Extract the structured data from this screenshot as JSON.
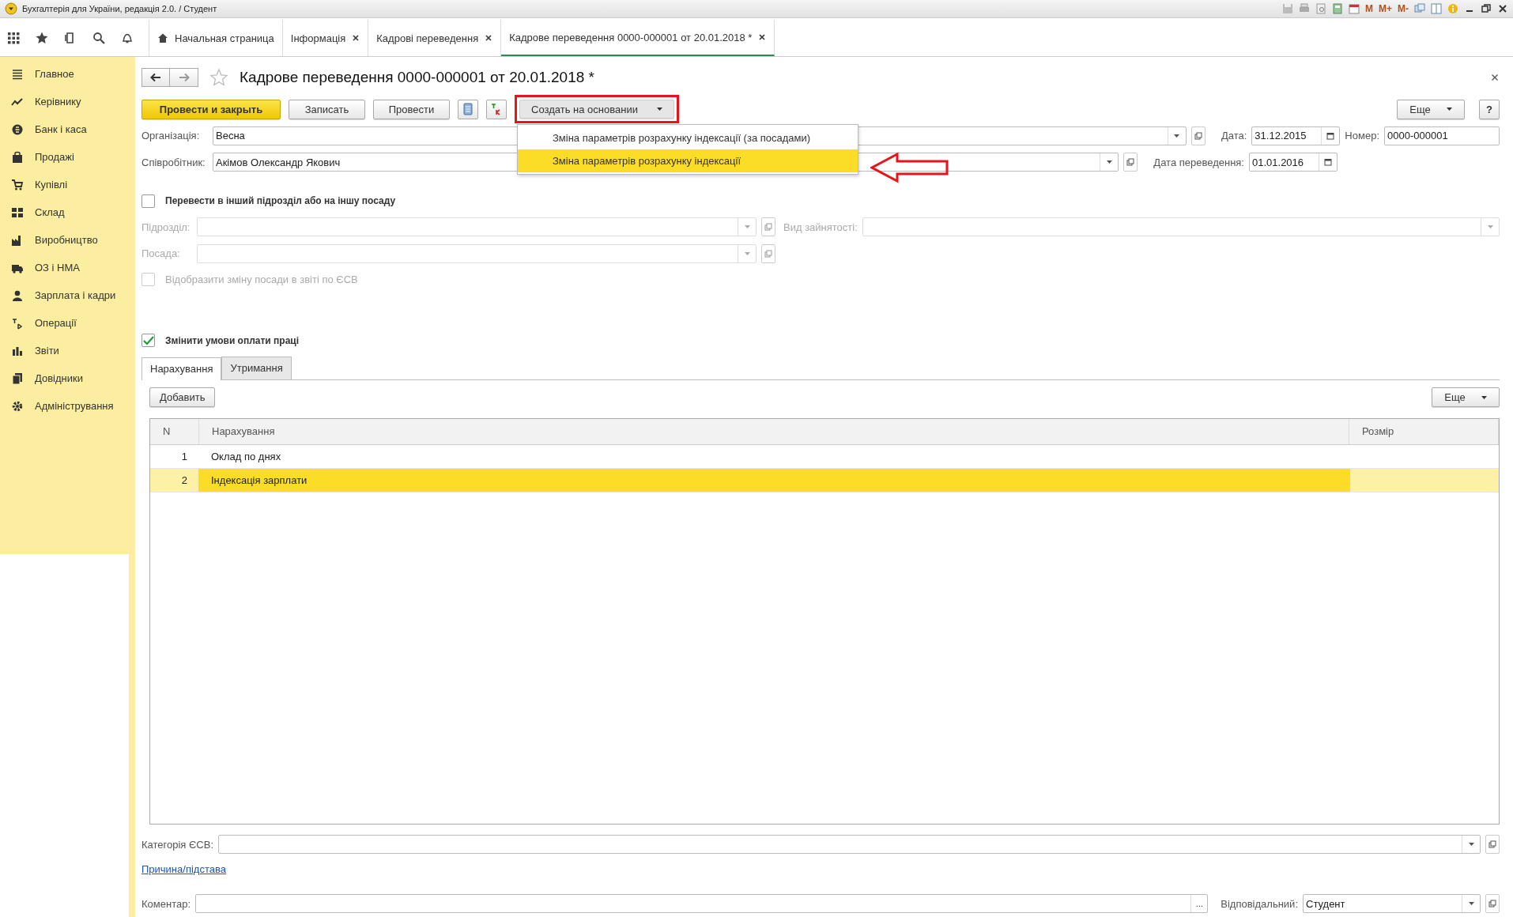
{
  "window": {
    "title": "Бухгалтерія для України, редакція 2.0. / Студент",
    "memory_buttons": [
      "M",
      "M+",
      "M-"
    ]
  },
  "tabs": [
    {
      "label": "Начальная страница",
      "selected": false,
      "closable": false
    },
    {
      "label": "Інформація",
      "selected": false,
      "closable": true
    },
    {
      "label": "Кадрові переведення",
      "selected": false,
      "closable": true
    },
    {
      "label": "Кадрове переведення 0000-000001 от 20.01.2018 *",
      "selected": true,
      "closable": true
    }
  ],
  "sidebar": {
    "items": [
      {
        "label": "Главное"
      },
      {
        "label": "Керівнику"
      },
      {
        "label": "Банк і каса"
      },
      {
        "label": "Продажі"
      },
      {
        "label": "Купівлі"
      },
      {
        "label": "Склад"
      },
      {
        "label": "Виробництво"
      },
      {
        "label": "ОЗ і НМА"
      },
      {
        "label": "Зарплата і кадри"
      },
      {
        "label": "Операції"
      },
      {
        "label": "Звіти"
      },
      {
        "label": "Довідники"
      },
      {
        "label": "Адміністрування"
      }
    ]
  },
  "document": {
    "title": "Кадрове переведення 0000-000001 от 20.01.2018 *",
    "favorite": false
  },
  "buttons": [
    {
      "label": "Провести и закрыть",
      "kind": "primary"
    },
    {
      "label": "Записать",
      "kind": "normal"
    },
    {
      "label": "Провести",
      "kind": "normal"
    }
  ],
  "create_based_on": {
    "label": "Создать на основании",
    "expanded": true,
    "menu": [
      {
        "label": "Зміна параметрів розрахунку індексації (за посадами)",
        "selected": false
      },
      {
        "label": "Зміна параметрів розрахунку індексації",
        "selected": true
      }
    ]
  },
  "more_button": "Еще",
  "help_button": "?",
  "organization": {
    "label": "Організація:",
    "value": "Весна"
  },
  "employee": {
    "label": "Співробітник:",
    "value": "Акімов Олександр Якович"
  },
  "date": {
    "label": "Дата:",
    "value": "31.12.2015"
  },
  "number": {
    "label": "Номер:",
    "value": "0000-000001"
  },
  "transfer_date": {
    "label": "Дата переведення:",
    "value": "01.01.2016"
  },
  "transfer_section": {
    "label": "Перевести в інший підрозділ або на іншу посаду",
    "checked": false,
    "department": {
      "label": "Підрозділ:"
    },
    "employment_type": {
      "label": "Вид зайнятості:"
    },
    "position": {
      "label": "Посада:"
    },
    "esv_option": {
      "label": "Відобразити зміну посади в звіті по ЄСВ",
      "checked": false
    }
  },
  "pay_section": {
    "label": "Змінити умови оплати праці",
    "checked": true
  },
  "subtabs": [
    {
      "label": "Нарахування",
      "selected": true
    },
    {
      "label": "Утримання",
      "selected": false
    }
  ],
  "add_button": "Добавить",
  "table_more_button": "Еще",
  "table": {
    "columns": [
      "N",
      "Нарахування",
      "Розмір"
    ],
    "rows": [
      {
        "n": "1",
        "accrual": "Оклад по днях",
        "selected": false
      },
      {
        "n": "2",
        "accrual": "Індексація зарплати",
        "selected": true
      }
    ]
  },
  "esv_category": {
    "label": "Категорія ЄСВ:"
  },
  "reason_link": "Причина/підстава",
  "comment": {
    "label": "Коментар:",
    "more": "..."
  },
  "responsible": {
    "label": "Відповідальний:",
    "value": "Студент"
  }
}
